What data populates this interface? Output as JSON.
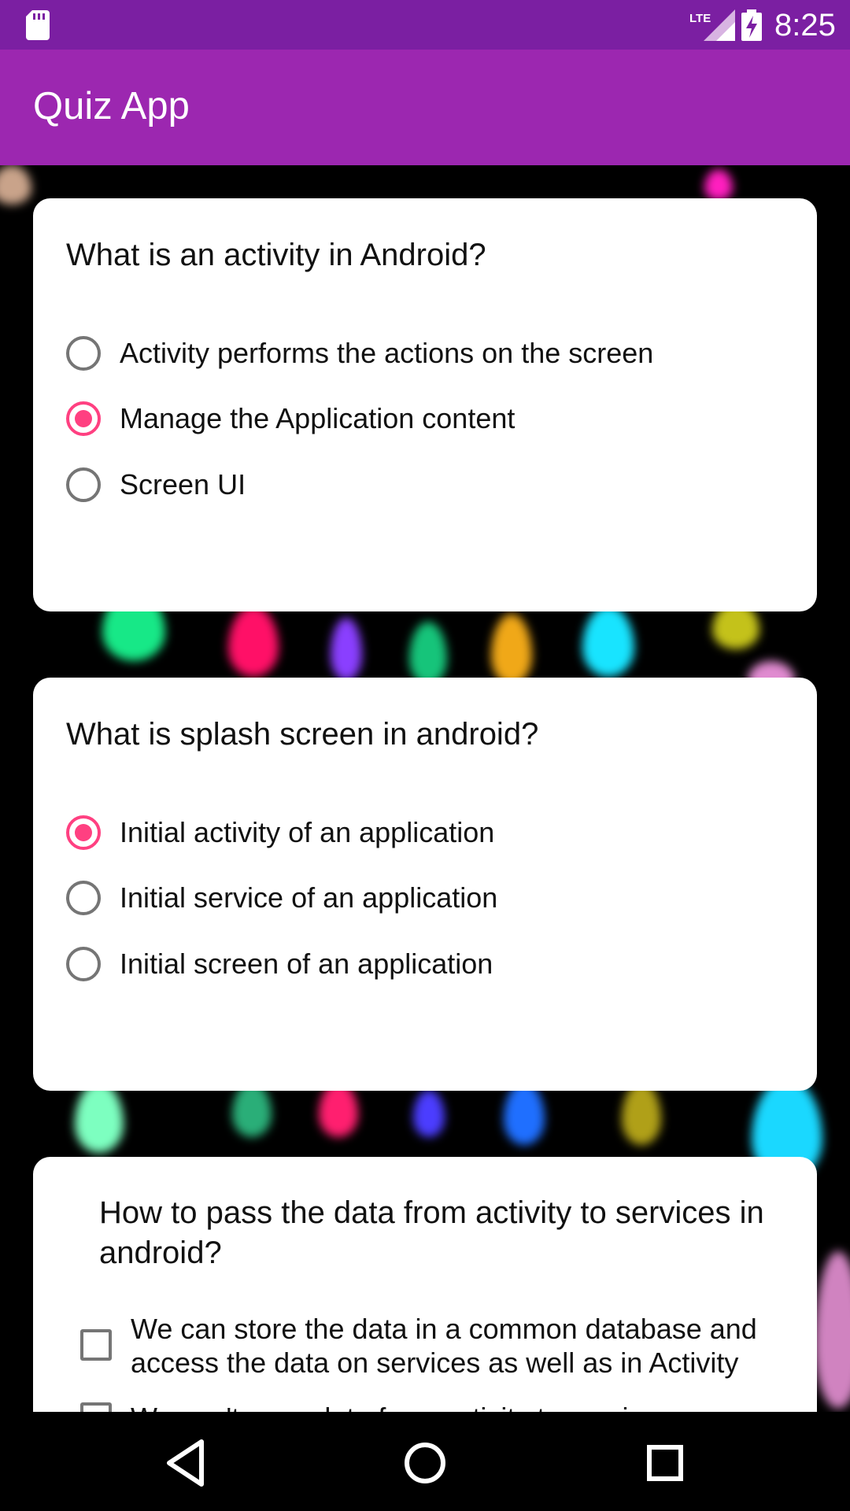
{
  "status_bar": {
    "time": "8:25",
    "network_label": "LTE",
    "icons": [
      "sd-card-icon",
      "lte-signal-icon",
      "battery-charging-icon"
    ]
  },
  "app_bar": {
    "title": "Quiz App",
    "color": "#9c27b0",
    "status_color": "#7b1fa2"
  },
  "questions": [
    {
      "question": "What is an activity in Android?",
      "type": "radio",
      "options": [
        {
          "label": "Activity performs the actions on the screen",
          "selected": false
        },
        {
          "label": "Manage the Application content",
          "selected": true
        },
        {
          "label": "Screen UI",
          "selected": false
        }
      ]
    },
    {
      "question": "What is splash screen in android?",
      "type": "radio",
      "options": [
        {
          "label": "Initial activity of an application",
          "selected": true
        },
        {
          "label": "Initial service of an application",
          "selected": false
        },
        {
          "label": "Initial screen of an application",
          "selected": false
        }
      ]
    },
    {
      "question": "How to pass the data from activity to services in android?",
      "type": "checkbox",
      "options": [
        {
          "label": "We can store the data in a common database and access the data on services as well as in Activity",
          "selected": false
        },
        {
          "label": "We can't pass data from activity to services",
          "selected": false
        }
      ]
    }
  ],
  "accent_color": "#ff4081",
  "nav_bar": {
    "buttons": [
      "back-icon",
      "home-icon",
      "recents-icon"
    ]
  }
}
